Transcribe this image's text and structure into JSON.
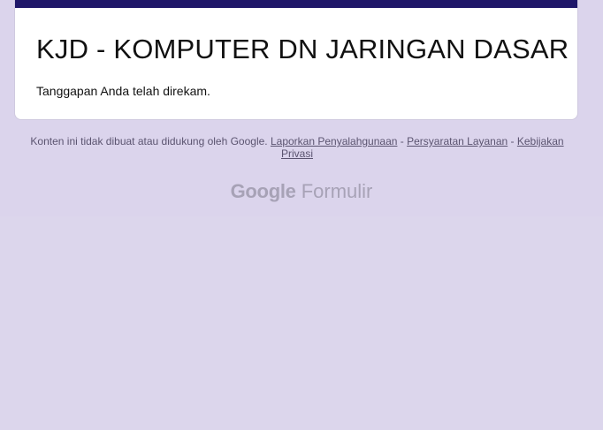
{
  "form": {
    "title": "KJD - KOMPUTER DN JARINGAN DASAR",
    "message": "Tanggapan Anda telah direkam."
  },
  "footer": {
    "disclaimer": "Konten ini tidak dibuat atau didukung oleh Google.",
    "separator": " - ",
    "report_abuse": "Laporkan Penyalahgunaan",
    "terms": "Persyaratan Layanan",
    "privacy": "Kebijakan Privasi"
  },
  "branding": {
    "google": "Google",
    "product": "Formulir"
  },
  "colors": {
    "accent": "#1f1769",
    "background": "#dcd6ec",
    "card": "#ffffff"
  }
}
